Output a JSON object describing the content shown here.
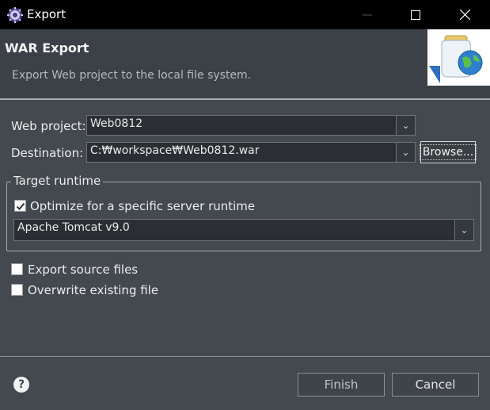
{
  "window": {
    "title": "Export",
    "minimize_icon": "minimize-icon",
    "maximize_icon": "maximize-icon",
    "close_icon": "close-icon"
  },
  "header": {
    "title": "WAR Export",
    "description": "Export Web project to the local file system."
  },
  "form": {
    "web_project_label": "Web project:",
    "web_project_value": "Web0812",
    "destination_label": "Destination:",
    "destination_value": "C:₩workspace₩Web0812.war",
    "browse_label": "Browse...",
    "target_runtime_group": "Target runtime",
    "optimize_label": "Optimize for a specific server runtime",
    "optimize_checked": true,
    "runtime_value": "Apache Tomcat v9.0",
    "export_source_label": "Export source files",
    "export_source_checked": false,
    "overwrite_label": "Overwrite existing file",
    "overwrite_checked": false
  },
  "footer": {
    "help_symbol": "?",
    "finish_label": "Finish",
    "cancel_label": "Cancel"
  }
}
